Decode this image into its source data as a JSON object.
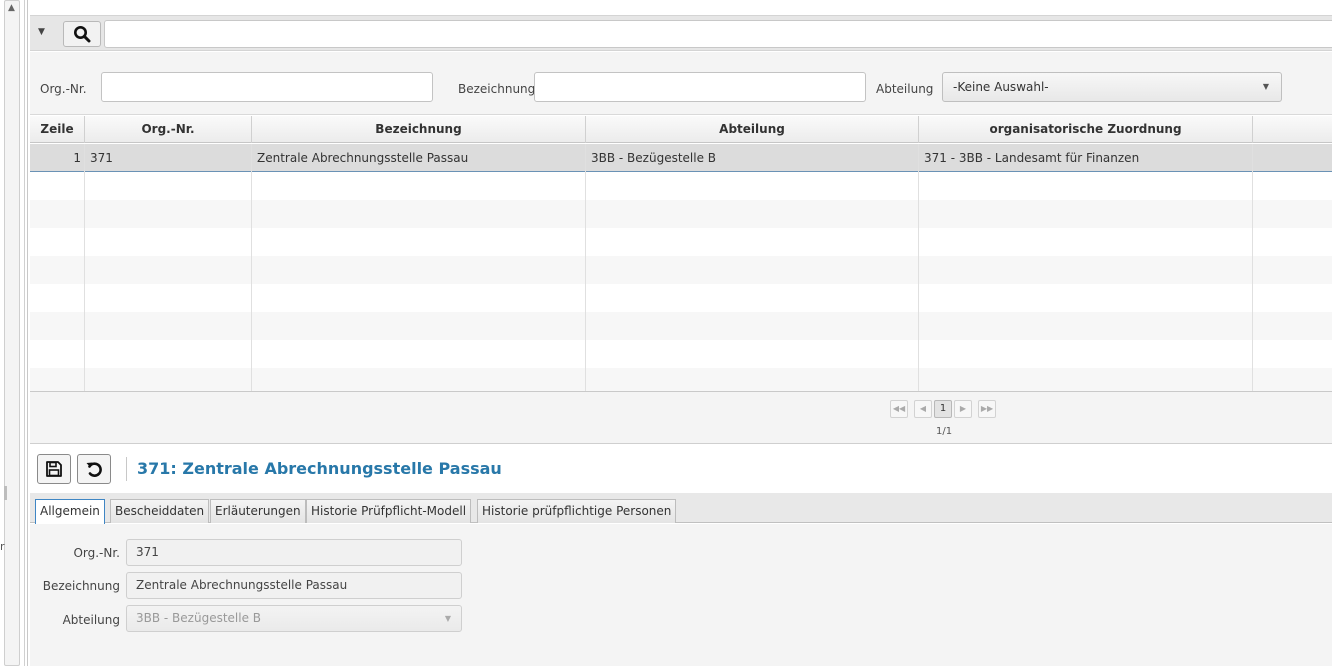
{
  "search": {
    "placeholder": ""
  },
  "filter": {
    "org_nr_label": "Org.-Nr.",
    "bezeichnung_label": "Bezeichnung",
    "abteilung_label": "Abteilung",
    "abteilung_selected": "-Keine Auswahl-"
  },
  "table": {
    "headers": [
      "Zeile",
      "Org.-Nr.",
      "Bezeichnung",
      "Abteilung",
      "organisatorische Zuordnung"
    ],
    "rows": [
      {
        "zeile": "1",
        "org_nr": "371",
        "bezeichnung": "Zentrale Abrechnungsstelle Passau",
        "abteilung": "3BB - Bezügestelle B",
        "zuordnung": "371 - 3BB - Landesamt für Finanzen"
      }
    ]
  },
  "pager": {
    "current": "1",
    "info": "1/1"
  },
  "detail": {
    "title": "371: Zentrale Abrechnungsstelle Passau",
    "tabs": [
      "Allgemein",
      "Bescheiddaten",
      "Erläuterungen",
      "Historie Prüfpflicht-Modell",
      "Historie prüfpflichtige Personen"
    ],
    "org_nr_label": "Org.-Nr.",
    "org_nr_value": "371",
    "bezeichnung_label": "Bezeichnung",
    "bezeichnung_value": "Zentrale Abrechnungsstelle Passau",
    "abteilung_label": "Abteilung",
    "abteilung_value": "3BB - Bezügestelle B"
  },
  "left_gutter_letter": "r",
  "colors": {
    "title_blue": "#2878a9",
    "selection_border": "#6a92b5",
    "active_tab_border": "#3f86c4"
  }
}
